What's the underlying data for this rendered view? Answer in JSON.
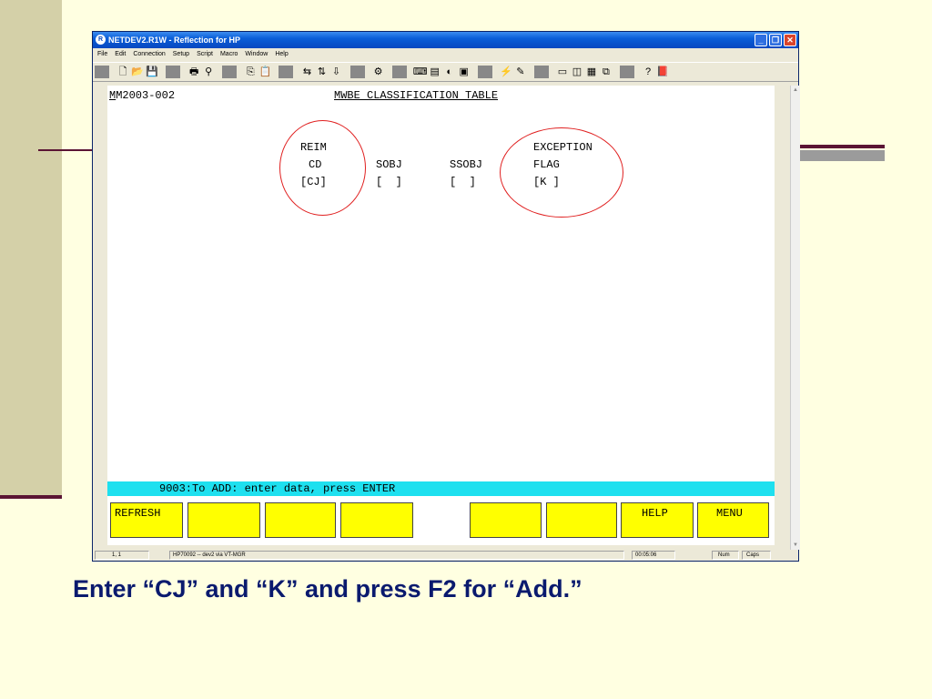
{
  "window": {
    "title": "NETDEV2.R1W - Reflection for HP",
    "menu": [
      "File",
      "Edit",
      "Connection",
      "Setup",
      "Script",
      "Macro",
      "Window",
      "Help"
    ],
    "buttons": {
      "minimize": "_",
      "restore": "❐",
      "close": "✕"
    }
  },
  "toolbar_icons": [
    "new-icon",
    "open-icon",
    "save-icon",
    "print-icon",
    "find-icon",
    "copy-icon",
    "paste-icon",
    "connect-icon",
    "transfer-icon",
    "receive-icon",
    "settings-icon",
    "keyboard-icon",
    "display-icon",
    "color-icon",
    "terminal-icon",
    "macro-icon",
    "record-icon",
    "screen-icon",
    "window-icon",
    "layout-icon",
    "cascade-icon",
    "whatsthis-icon",
    "book-icon"
  ],
  "terminal": {
    "screen_id_first": "M",
    "screen_id_rest": "M2003-002",
    "screen_title": "MWBE CLASSIFICATION TABLE",
    "fields": {
      "reim_line1": "REIM",
      "reim_line2": "CD",
      "reim_value": "[CJ]",
      "sobj_label": "SOBJ",
      "sobj_value": "[  ]",
      "ssobj_label": "SSOBJ",
      "ssobj_value": "[  ]",
      "exception_line1": "EXCEPTION",
      "exception_line2": "FLAG",
      "exception_value": "[K ]"
    },
    "message": "9003:To ADD: enter data, press ENTER",
    "function_keys": [
      "REFRESH",
      "",
      "",
      "",
      "",
      "",
      "",
      "HELP",
      "MENU"
    ]
  },
  "status_bar": {
    "position": "1, 1",
    "connection": "HP70092 -- dev2 via VT-MGR",
    "timer": "00:05:06",
    "num": "Num",
    "caps": "Caps"
  },
  "caption": "Enter “CJ” and “K” and press F2 for “Add.”",
  "colors": {
    "background": "#ffffe1",
    "accent_band": "#d4d0a8",
    "rule": "#5b1434",
    "titlebar": "#0848c0",
    "function_key": "#ffff00",
    "message_bar": "#1ee0ef",
    "annotation_circle": "#e02020",
    "caption": "#0a1a6e"
  }
}
